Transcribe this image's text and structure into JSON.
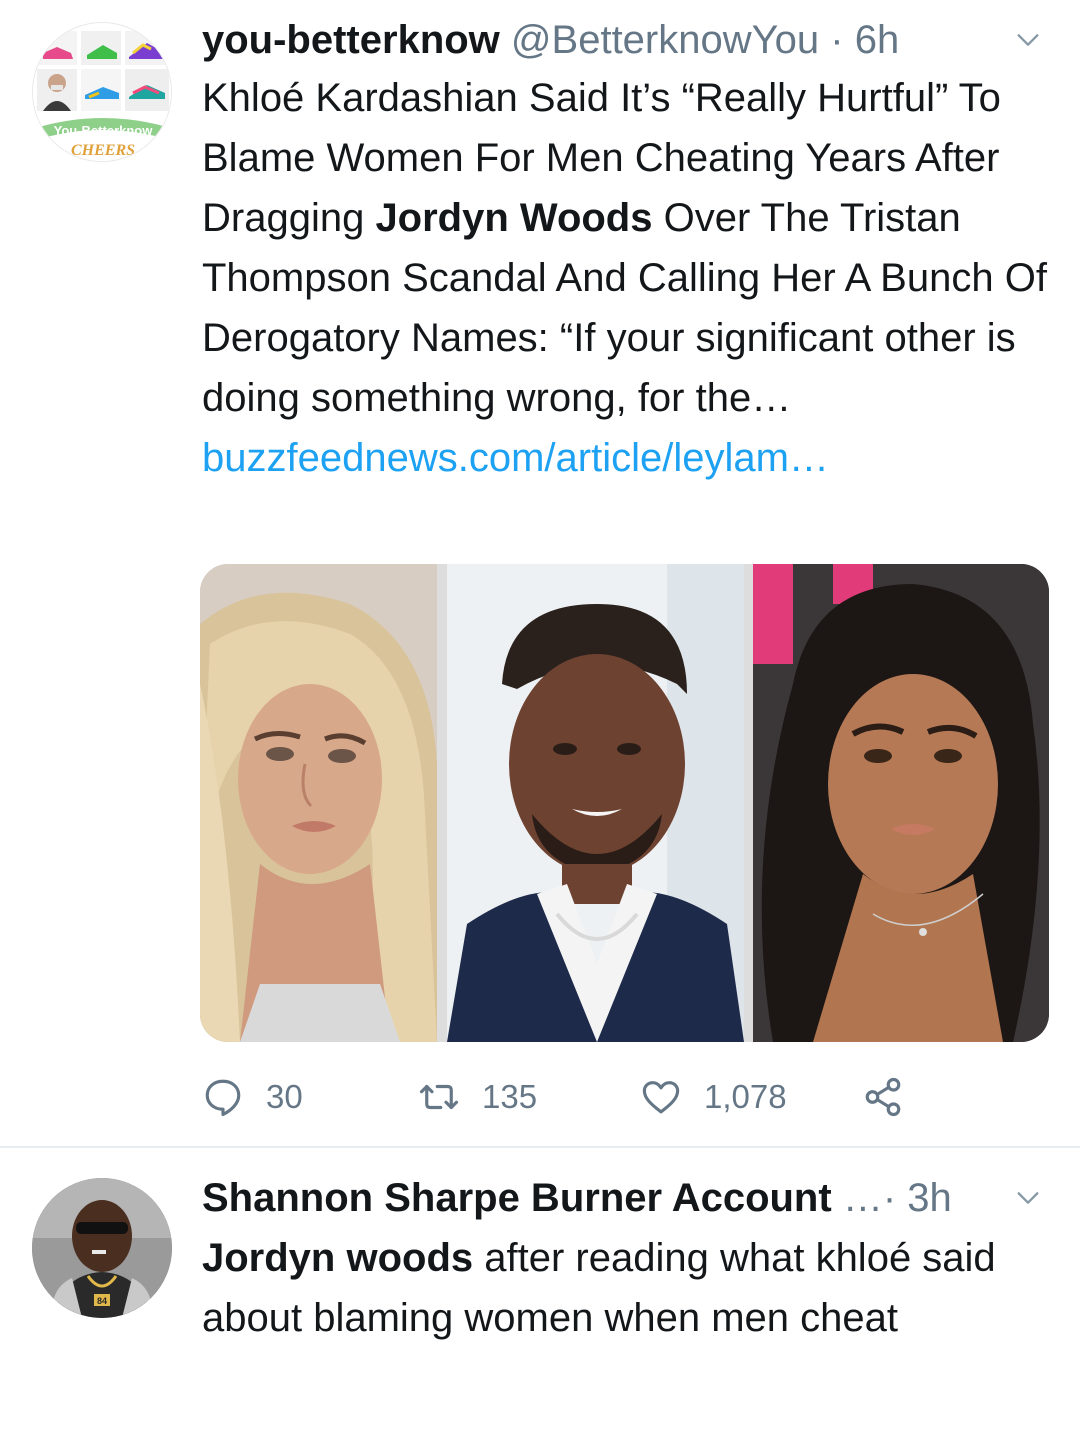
{
  "tweet1": {
    "display_name": "you-betterknow",
    "handle": "@BetterknowYou",
    "separator": "·",
    "time": "6h",
    "avatar_text_top": "You-Betterknow",
    "avatar_text_bottom": "CHEERS",
    "text_part1": "Khloé Kardashian Said It’s “Really Hurtful” To Blame Women For Men Cheating Years After Dragging ",
    "text_bold": "Jordyn Woods",
    "text_part2": " Over The Tristan Thompson Scandal And Calling Her A Bunch Of Derogatory Names: “If your significant other is doing something wrong, for the…",
    "link": "buzzfeednews.com/article/leylam…",
    "reply_count": "30",
    "retweet_count": "135",
    "like_count": "1,078"
  },
  "tweet2": {
    "display_name": "Shannon Sharpe Burner Account",
    "separator": "…·",
    "time": "3h",
    "avatar_jersey": "84",
    "text_bold": "Jordyn woods",
    "text_rest": " after reading what khloé said about blaming women when men cheat"
  },
  "colors": {
    "link": "#1da1f2",
    "secondary_text": "#657786",
    "primary_text": "#14171a",
    "divider": "#e6ecf0"
  },
  "icons": [
    "chevron-down-icon",
    "reply-icon",
    "retweet-icon",
    "like-icon",
    "share-icon"
  ]
}
